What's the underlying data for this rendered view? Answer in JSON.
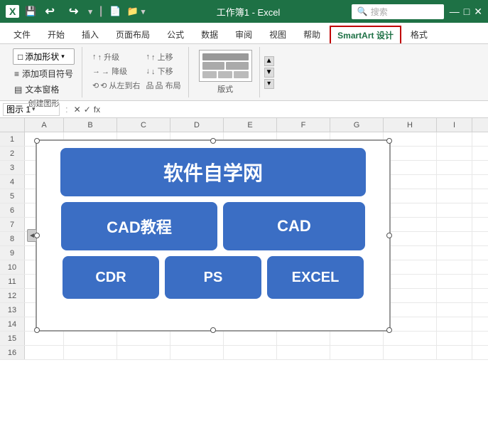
{
  "titleBar": {
    "appName": "X",
    "fileName": "工作簿1 - Excel",
    "searchPlaceholder": "搜索"
  },
  "ribbonTabs": {
    "tabs": [
      "文件",
      "开始",
      "插入",
      "页面布局",
      "公式",
      "数据",
      "审阅",
      "视图",
      "帮助",
      "SmartArt 设计",
      "格式"
    ]
  },
  "ribbonGroups": {
    "createShape": {
      "label": "创建图形",
      "addShape": "添加形状",
      "addBullet": "添加项目符号",
      "textPane": "文本窗格",
      "promote": "↑ 升级",
      "demote": "→ 降级",
      "moveUp": "↑ 上移",
      "moveDown": "↓ 下移",
      "leftToRight": "⟲ 从左到右",
      "layout": "品 布局"
    },
    "layout": {
      "label": "版式"
    }
  },
  "formulaBar": {
    "nameBox": "图示 1",
    "cancelSymbol": "✕",
    "confirmSymbol": "✓",
    "funcSymbol": "fx"
  },
  "columns": [
    "A",
    "B",
    "C",
    "D",
    "E",
    "F",
    "G",
    "H",
    "I"
  ],
  "rows": [
    "1",
    "2",
    "3",
    "4",
    "5",
    "6",
    "7",
    "8",
    "9",
    "10",
    "11",
    "12",
    "13",
    "14",
    "15",
    "16"
  ],
  "smartart": {
    "topBox": "软件自学网",
    "midLeft": "CAD教程",
    "midRight": "CAD",
    "botLeft": "CDR",
    "botMid": "PS",
    "botRight": "EXCEL"
  }
}
